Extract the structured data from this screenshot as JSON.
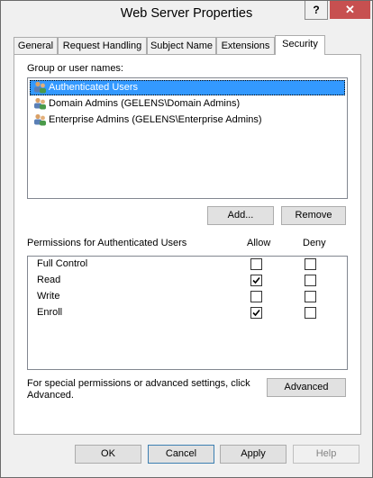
{
  "window": {
    "title": "Web Server Properties",
    "help_label": "?",
    "close_label": "✕"
  },
  "tabs": [
    {
      "label": "General"
    },
    {
      "label": "Request Handling"
    },
    {
      "label": "Subject Name"
    },
    {
      "label": "Extensions"
    },
    {
      "label": "Security",
      "active": true
    }
  ],
  "security": {
    "group_label": "Group or user names:",
    "users": [
      {
        "name": "Authenticated Users",
        "selected": true,
        "icon": "users-icon"
      },
      {
        "name": "Domain Admins (GELENS\\Domain Admins)",
        "selected": false,
        "icon": "users-icon"
      },
      {
        "name": "Enterprise Admins (GELENS\\Enterprise Admins)",
        "selected": false,
        "icon": "users-icon"
      }
    ],
    "add_label": "Add...",
    "remove_label": "Remove",
    "permissions_label": "Permissions for Authenticated Users",
    "allow_header": "Allow",
    "deny_header": "Deny",
    "permissions": [
      {
        "name": "Full Control",
        "allow": false,
        "deny": false
      },
      {
        "name": "Read",
        "allow": true,
        "deny": false
      },
      {
        "name": "Write",
        "allow": false,
        "deny": false
      },
      {
        "name": "Enroll",
        "allow": true,
        "deny": false
      }
    ],
    "special_text_line1": "For special permissions or advanced settings, click",
    "special_text_line2": "Advanced.",
    "advanced_label": "Advanced"
  },
  "buttons": {
    "ok": "OK",
    "cancel": "Cancel",
    "apply": "Apply",
    "help": "Help"
  },
  "colors": {
    "selection": "#3399ff",
    "close_button": "#c75050"
  }
}
